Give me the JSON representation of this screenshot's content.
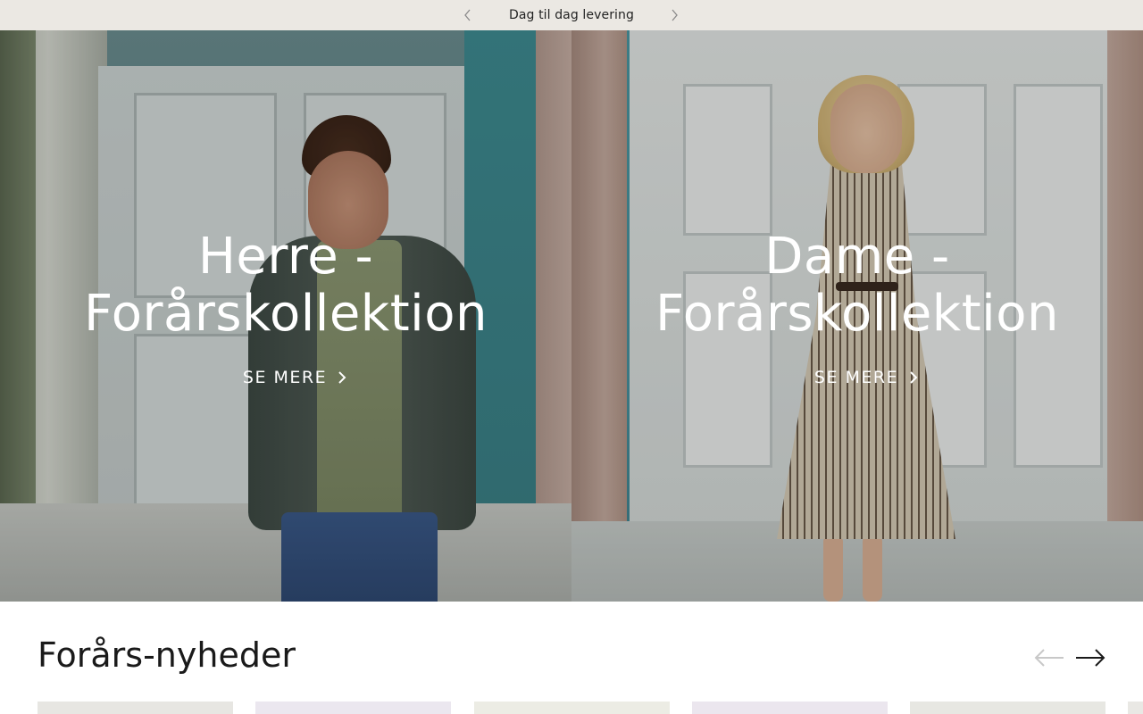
{
  "announcement": {
    "text": "Dag til dag levering",
    "prev_icon": "chevron-left-icon",
    "next_icon": "chevron-right-icon"
  },
  "hero": {
    "panels": [
      {
        "title_line1": "Herre -",
        "title_line2": "Forårskollektion",
        "cta": "SE MERE"
      },
      {
        "title_line1": "Dame -",
        "title_line2": "Forårskollektion",
        "cta": "SE MERE"
      }
    ]
  },
  "products": {
    "title": "Forårs-nyheder",
    "prev_icon": "arrow-left-icon",
    "next_icon": "arrow-right-icon",
    "card_colors": [
      "#e7e6e2",
      "#ebe7ef",
      "#ecece4",
      "#ebe6ee",
      "#e7e7e2"
    ]
  }
}
